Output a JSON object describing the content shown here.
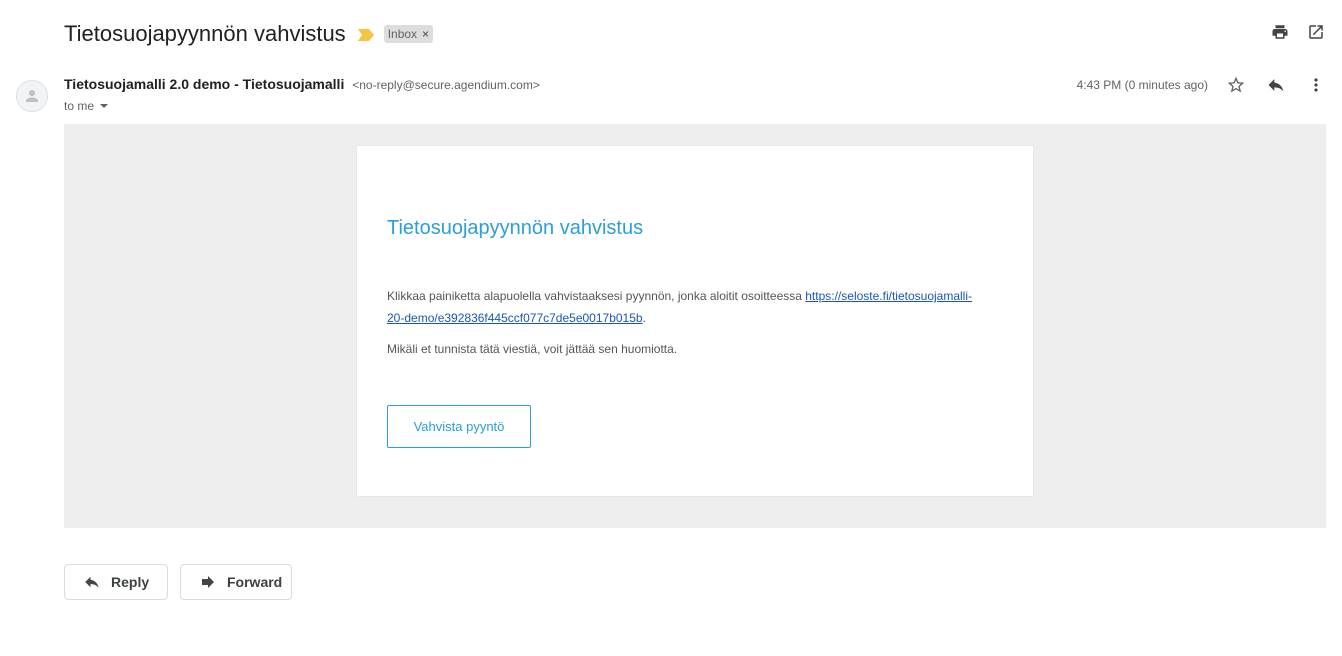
{
  "subject": {
    "title": "Tietosuojapyynnön vahvistus",
    "importance_icon": "importance-marker-icon",
    "importance_color": "#f4c542",
    "label": "Inbox",
    "label_close": "×"
  },
  "top_actions": {
    "print_icon": "print-icon",
    "new_window_icon": "open-in-new-window-icon"
  },
  "message": {
    "sender_name": "Tietosuojamalli 2.0 demo - Tietosuojamalli",
    "sender_email": "<no-reply@secure.agendium.com>",
    "recipient": "to me",
    "timestamp": "4:43 PM (0 minutes ago)",
    "star_icon": "star-icon",
    "reply_icon": "reply-icon",
    "more_icon": "more-vert-icon"
  },
  "body": {
    "heading": "Tietosuojapyynnön vahvistus",
    "paragraph1_text": "Klikkaa painiketta alapuolella vahvistaaksesi pyynnön, jonka aloitit osoitteessa ",
    "paragraph1_link": "https://seloste.fi/tietosuojamalli-20-demo/e392836f445ccf077c7de5e0017b015b",
    "paragraph1_end": ".",
    "paragraph2": "Mikäli et tunnista tätä viestiä, voit jättää sen huomiotta.",
    "button_label": "Vahvista pyyntö",
    "accent_color": "#2a9fd8"
  },
  "footer": {
    "reply_label": "Reply",
    "forward_label": "Forward"
  }
}
